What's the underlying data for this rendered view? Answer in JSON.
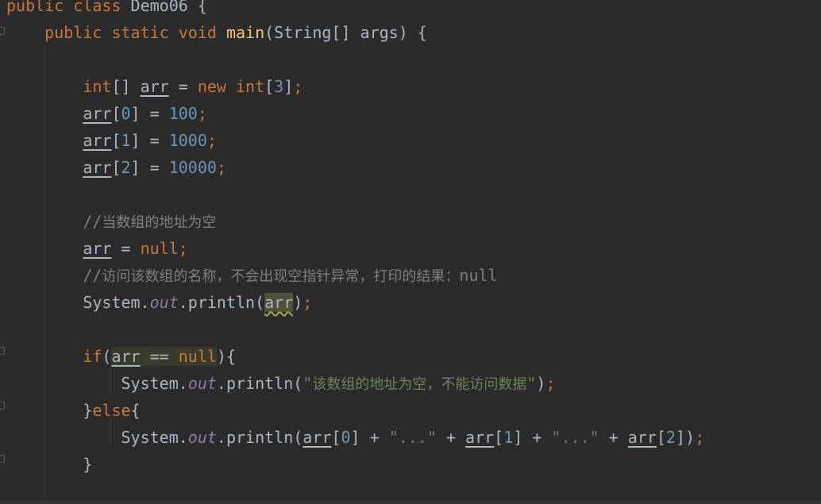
{
  "editor": {
    "language": "Java",
    "lines": [
      [
        {
          "t": "public class ",
          "c": "keyword"
        },
        {
          "t": "Demo06 {",
          "c": "plain"
        }
      ],
      [
        {
          "t": "    ",
          "c": "plain"
        },
        {
          "t": "public static void ",
          "c": "keyword"
        },
        {
          "t": "main",
          "c": "method-decl"
        },
        {
          "t": "(String[] args) {",
          "c": "plain"
        }
      ],
      [],
      [
        {
          "t": "        ",
          "c": "plain"
        },
        {
          "t": "int",
          "c": "keyword"
        },
        {
          "t": "[] ",
          "c": "plain"
        },
        {
          "t": "arr",
          "c": "var"
        },
        {
          "t": " = ",
          "c": "plain"
        },
        {
          "t": "new int",
          "c": "keyword"
        },
        {
          "t": "[",
          "c": "plain"
        },
        {
          "t": "3",
          "c": "number"
        },
        {
          "t": "]",
          "c": "plain"
        },
        {
          "t": ";",
          "c": "punct"
        }
      ],
      [
        {
          "t": "        ",
          "c": "plain"
        },
        {
          "t": "arr",
          "c": "var"
        },
        {
          "t": "[",
          "c": "plain"
        },
        {
          "t": "0",
          "c": "number"
        },
        {
          "t": "] = ",
          "c": "plain"
        },
        {
          "t": "100",
          "c": "number"
        },
        {
          "t": ";",
          "c": "punct"
        }
      ],
      [
        {
          "t": "        ",
          "c": "plain"
        },
        {
          "t": "arr",
          "c": "var"
        },
        {
          "t": "[",
          "c": "plain"
        },
        {
          "t": "1",
          "c": "number"
        },
        {
          "t": "] = ",
          "c": "plain"
        },
        {
          "t": "1000",
          "c": "number"
        },
        {
          "t": ";",
          "c": "punct"
        }
      ],
      [
        {
          "t": "        ",
          "c": "plain"
        },
        {
          "t": "arr",
          "c": "var"
        },
        {
          "t": "[",
          "c": "plain"
        },
        {
          "t": "2",
          "c": "number"
        },
        {
          "t": "] = ",
          "c": "plain"
        },
        {
          "t": "10000",
          "c": "number"
        },
        {
          "t": ";",
          "c": "punct"
        }
      ],
      [],
      [
        {
          "t": "        ",
          "c": "plain"
        },
        {
          "t": "//",
          "c": "comment"
        },
        {
          "t": "当数组的地址为空",
          "c": "comment-cjk"
        }
      ],
      [
        {
          "t": "        ",
          "c": "plain"
        },
        {
          "t": "arr",
          "c": "var"
        },
        {
          "t": " = ",
          "c": "plain"
        },
        {
          "t": "null",
          "c": "keyword"
        },
        {
          "t": ";",
          "c": "punct"
        }
      ],
      [
        {
          "t": "        ",
          "c": "plain"
        },
        {
          "t": "//",
          "c": "comment"
        },
        {
          "t": "访问该数组的名称，不会出现空指针异常，打印的结果：",
          "c": "comment-cjk"
        },
        {
          "t": "null",
          "c": "comment"
        }
      ],
      [
        {
          "t": "        ",
          "c": "plain"
        },
        {
          "t": "System.",
          "c": "plain"
        },
        {
          "t": "out",
          "c": "field"
        },
        {
          "t": ".println(",
          "c": "plain"
        },
        {
          "t": "arr",
          "c": "var",
          "hl": "warn"
        },
        {
          "t": ")",
          "c": "plain"
        },
        {
          "t": ";",
          "c": "punct"
        }
      ],
      [],
      [
        {
          "t": "        ",
          "c": "plain"
        },
        {
          "t": "if",
          "c": "keyword"
        },
        {
          "t": "(",
          "c": "plain"
        },
        {
          "t": "arr",
          "c": "var",
          "hl": "match"
        },
        {
          "t": " == ",
          "c": "plain",
          "hl": "match"
        },
        {
          "t": "null",
          "c": "keyword",
          "hl": "match"
        },
        {
          "t": "){",
          "c": "plain"
        }
      ],
      [
        {
          "t": "            ",
          "c": "plain"
        },
        {
          "t": "System.",
          "c": "plain"
        },
        {
          "t": "out",
          "c": "field"
        },
        {
          "t": ".println(",
          "c": "plain"
        },
        {
          "t": "\"",
          "c": "string"
        },
        {
          "t": "该数组的地址为空，不能访问数据",
          "c": "string-cjk"
        },
        {
          "t": "\"",
          "c": "string"
        },
        {
          "t": ")",
          "c": "plain"
        },
        {
          "t": ";",
          "c": "punct"
        }
      ],
      [
        {
          "t": "        ",
          "c": "plain"
        },
        {
          "t": "}",
          "c": "plain"
        },
        {
          "t": "else",
          "c": "keyword"
        },
        {
          "t": "{",
          "c": "plain"
        }
      ],
      [
        {
          "t": "            ",
          "c": "plain"
        },
        {
          "t": "System.",
          "c": "plain"
        },
        {
          "t": "out",
          "c": "field"
        },
        {
          "t": ".println(",
          "c": "plain"
        },
        {
          "t": "arr",
          "c": "var"
        },
        {
          "t": "[",
          "c": "plain"
        },
        {
          "t": "0",
          "c": "number"
        },
        {
          "t": "] + ",
          "c": "plain"
        },
        {
          "t": "\"...\"",
          "c": "string"
        },
        {
          "t": " + ",
          "c": "plain"
        },
        {
          "t": "arr",
          "c": "var"
        },
        {
          "t": "[",
          "c": "plain"
        },
        {
          "t": "1",
          "c": "number"
        },
        {
          "t": "] + ",
          "c": "plain"
        },
        {
          "t": "\"...\"",
          "c": "string"
        },
        {
          "t": " + ",
          "c": "plain"
        },
        {
          "t": "arr",
          "c": "var"
        },
        {
          "t": "[",
          "c": "plain"
        },
        {
          "t": "2",
          "c": "number"
        },
        {
          "t": "])",
          "c": "plain"
        },
        {
          "t": ";",
          "c": "punct"
        }
      ],
      [
        {
          "t": "        ",
          "c": "plain"
        },
        {
          "t": "}",
          "c": "plain"
        }
      ]
    ]
  },
  "colors": {
    "background": "#2b2b2b",
    "keyword": "#cc7832",
    "method_decl": "#ffc66d",
    "number": "#6897bb",
    "string": "#6a8759",
    "comment": "#808080",
    "field": "#9876aa",
    "plain": "#a9b7c6"
  },
  "icons": {
    "fold_marker": "fold-marker-icon"
  }
}
